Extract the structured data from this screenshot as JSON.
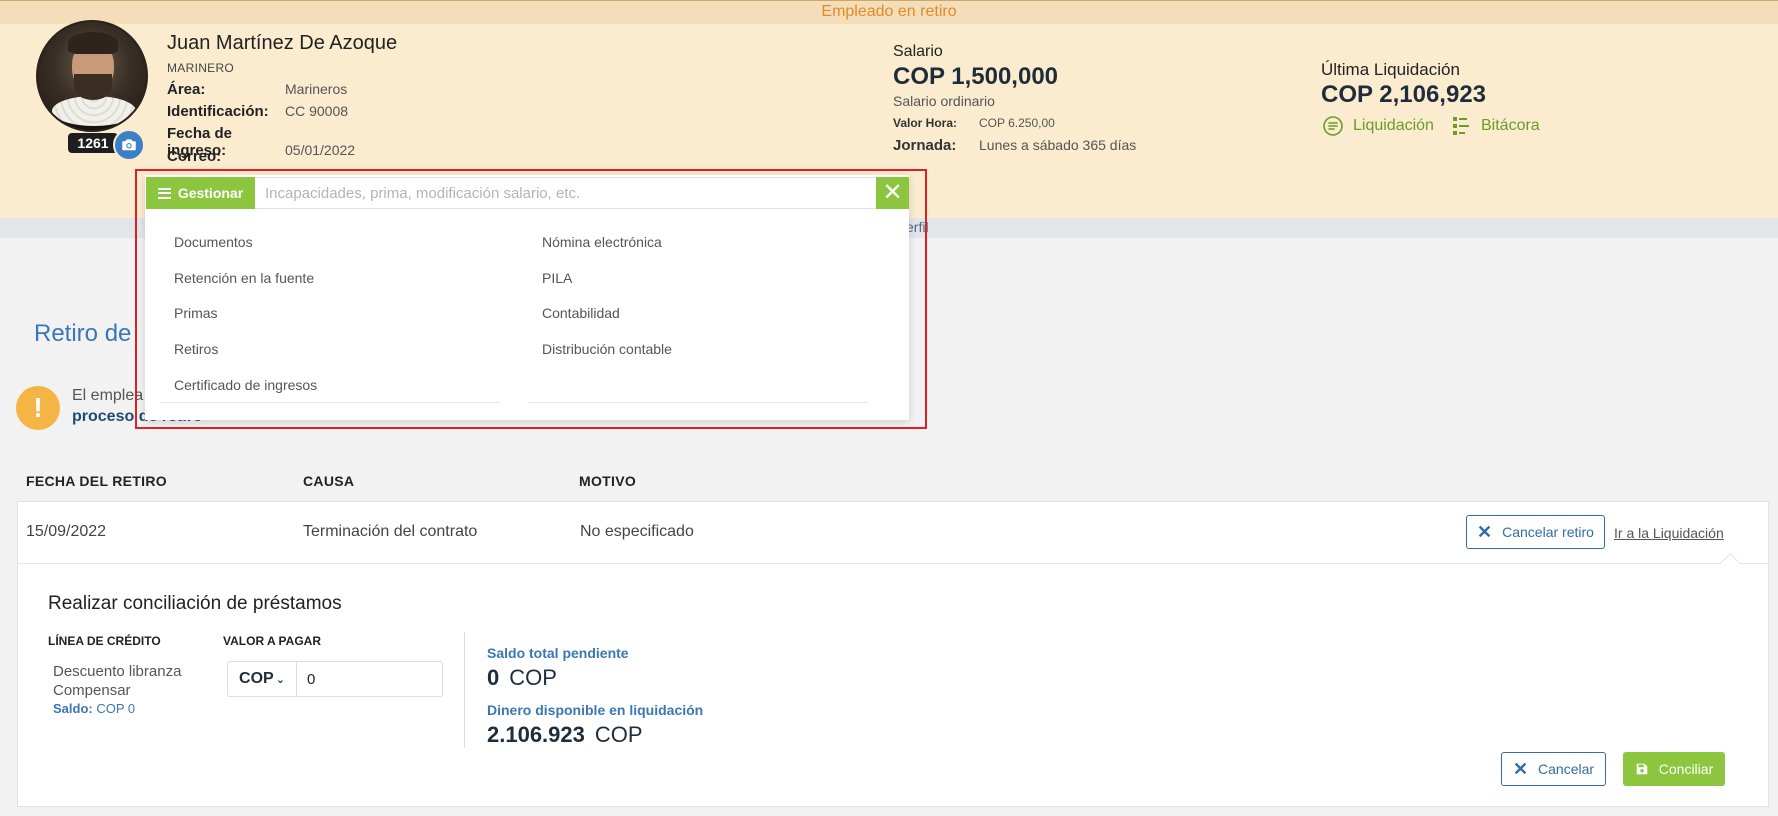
{
  "status_banner": "Empleado en retiro",
  "employee": {
    "name": "Juan Martínez De Azoque",
    "role": "MARINERO",
    "badge_number": "1261",
    "area_label": "Área:",
    "area_value": "Marineros",
    "id_label": "Identificación:",
    "id_value": "CC 90008",
    "start_label": "Fecha de ingreso:",
    "start_value": "05/01/2022",
    "email_label": "Correo:",
    "email_value": ""
  },
  "salary": {
    "label": "Salario",
    "value": "COP 1,500,000",
    "subtitle": "Salario ordinario",
    "hour_label": "Valor Hora:",
    "hour_value": "COP 6.250,00",
    "schedule_label": "Jornada:",
    "schedule_value": "Lunes a sábado 365 días"
  },
  "last_settlement": {
    "label": "Última Liquidación",
    "value": "COP 2,106,923",
    "liquidacion_link": "Liquidación",
    "bitacora_link": "Bitácora"
  },
  "sub_bar_text": "erfil",
  "page": {
    "title": "Retiro de",
    "alert_text": "El emplea",
    "alert_strong": "proceso de retiro"
  },
  "retirement_table": {
    "headers": [
      "FECHA DEL RETIRO",
      "CAUSA",
      "MOTIVO"
    ],
    "row": {
      "date": "15/09/2022",
      "cause": "Terminación del contrato",
      "reason": "No especificado"
    },
    "cancel_button": "Cancelar retiro",
    "go_link": "Ir a la Liquidación"
  },
  "conciliation": {
    "title": "Realizar conciliación de préstamos",
    "col_credit": "LÍNEA DE CRÉDITO",
    "col_pay": "VALOR A PAGAR",
    "credit_line": "Descuento libranza",
    "credit_line_2": "Compensar",
    "saldo_label": "Saldo:",
    "saldo_value": "COP 0",
    "currency": "COP",
    "pay_value": "0",
    "pending_label": "Saldo total pendiente",
    "pending_amount": "0",
    "pending_currency": "COP",
    "available_label": "Dinero disponible en liquidación",
    "available_amount": "2.106.923",
    "available_currency": "COP",
    "cancel_button": "Cancelar",
    "submit_button": "Conciliar"
  },
  "gestionar": {
    "button": "Gestionar",
    "placeholder": "Incapacidades, prima, modificación salario, etc.",
    "left_items": [
      "Documentos",
      "Retención en la fuente",
      "Primas",
      "Retiros",
      "Certificado de ingresos"
    ],
    "right_items": [
      "Nómina electrónica",
      "PILA",
      "Contabilidad",
      "Distribución contable"
    ]
  },
  "colors": {
    "accent_green": "#8cc63e",
    "link_blue": "#3a77b6",
    "banner_orange": "#e38a2a",
    "highlight_red": "#e02020"
  }
}
